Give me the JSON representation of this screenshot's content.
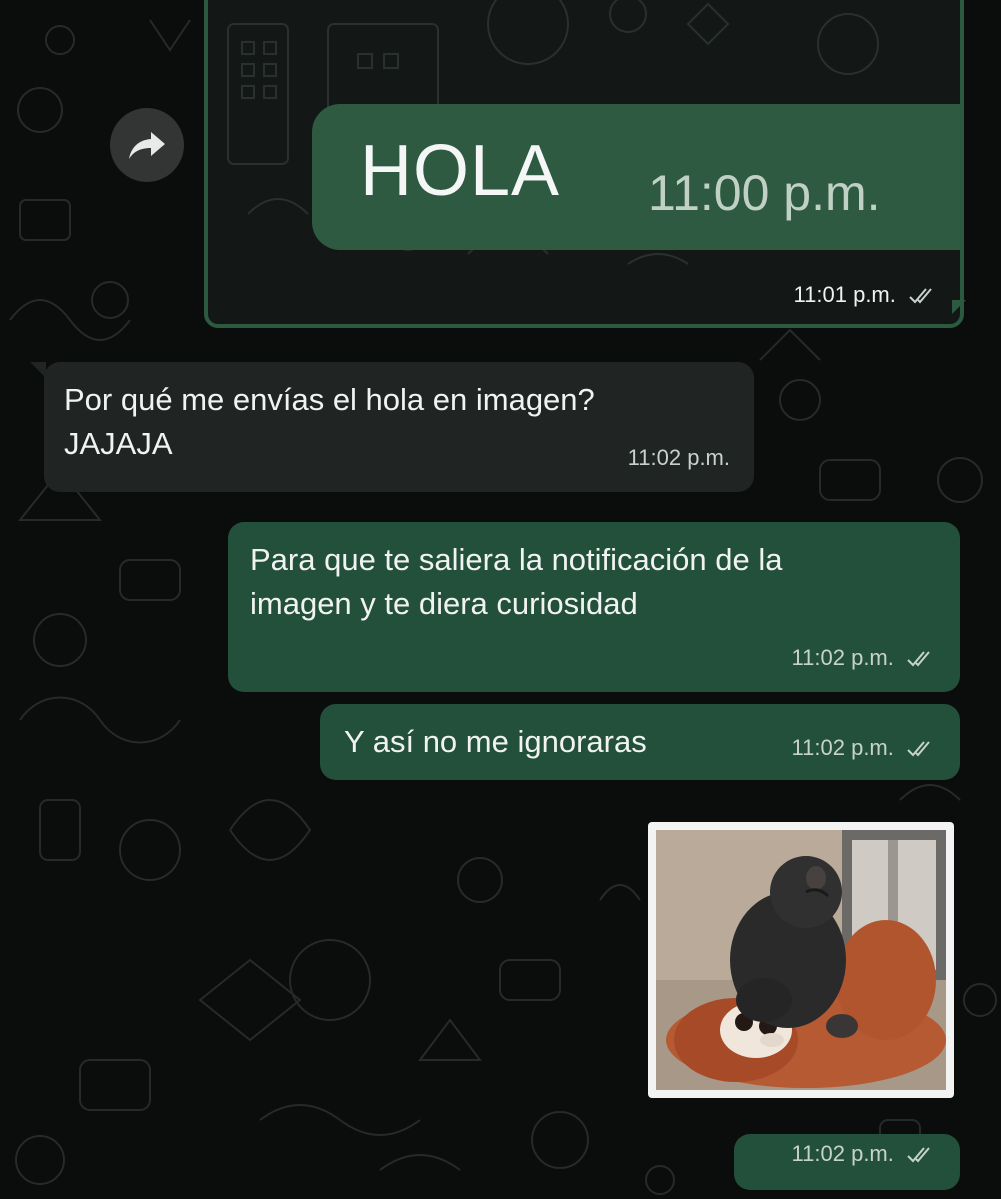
{
  "chat": {
    "image_message": {
      "inner_text": "HOLA",
      "inner_time": "11:00 p.m.",
      "time": "11:01 p.m."
    },
    "messages": [
      {
        "direction": "incoming",
        "line1": "Por qué me envías el hola en imagen?",
        "line2": "JAJAJA",
        "time": "11:02 p.m."
      },
      {
        "direction": "outgoing",
        "line1": "Para que te saliera la notificación de la",
        "line2": "imagen y te diera curiosidad",
        "time": "11:02 p.m."
      },
      {
        "direction": "outgoing",
        "text": "Y así no me ignoraras",
        "time": "11:02 p.m."
      }
    ],
    "sticker_message": {
      "time": "11:02 p.m."
    }
  },
  "icons": [
    "forward-icon",
    "double-check-icon"
  ],
  "colors": {
    "background": "#0b0c0c",
    "incoming_bubble": "#202423",
    "outgoing_bubble": "#22503a",
    "image_border": "#2c5a41"
  }
}
